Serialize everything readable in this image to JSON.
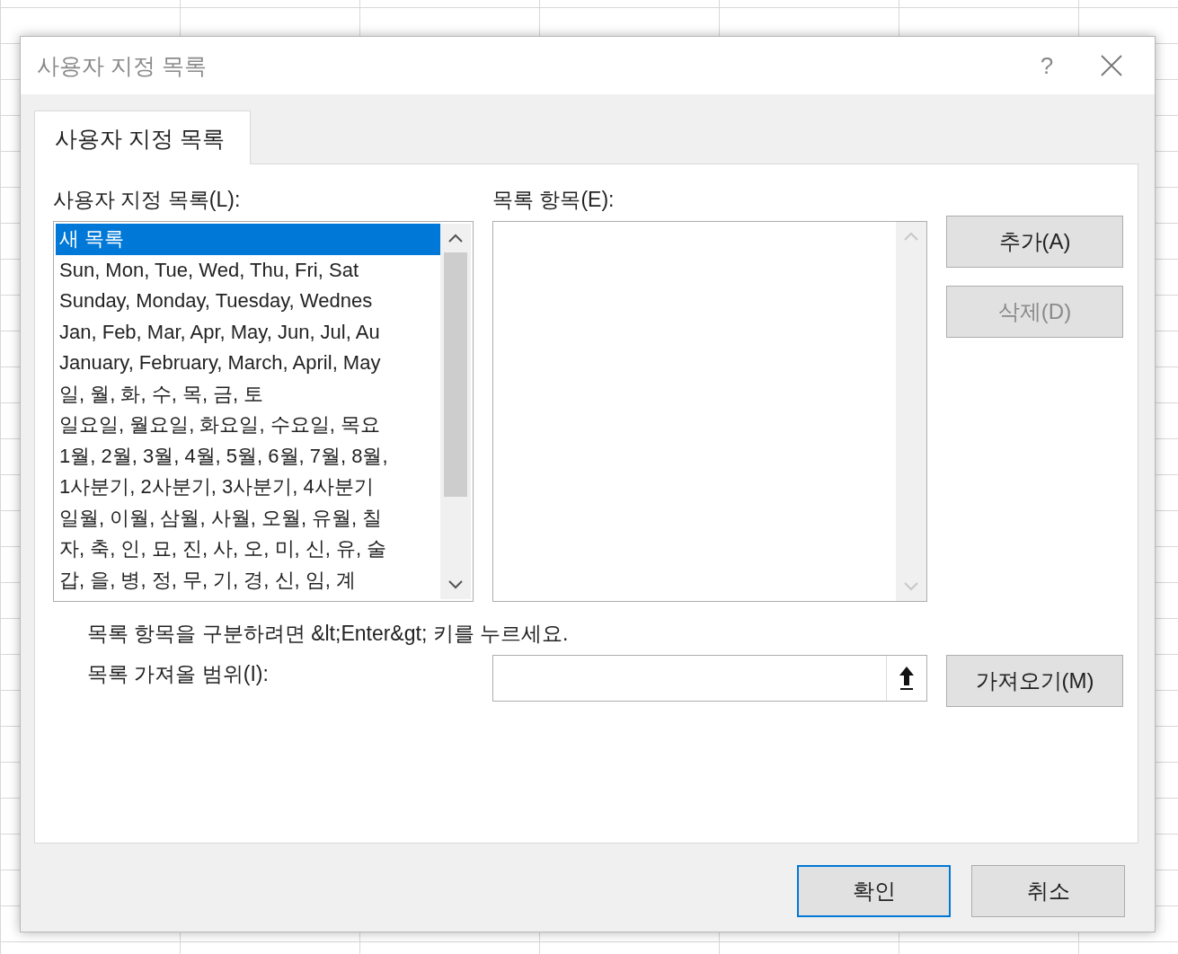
{
  "window": {
    "title": "사용자 지정 목록",
    "help": "?"
  },
  "tabs": [
    {
      "label": "사용자 지정 목록",
      "selected": true
    }
  ],
  "custom_lists": {
    "label": "사용자 지정 목록(L):",
    "items": [
      {
        "text": "새 목록",
        "selected": true
      },
      {
        "text": "Sun, Mon, Tue, Wed, Thu, Fri, Sat",
        "selected": false
      },
      {
        "text": "Sunday, Monday, Tuesday, Wednes",
        "selected": false
      },
      {
        "text": "Jan, Feb, Mar, Apr, May, Jun, Jul, Au",
        "selected": false
      },
      {
        "text": "January, February, March, April, May",
        "selected": false
      },
      {
        "text": "일, 월, 화, 수, 목, 금, 토",
        "selected": false
      },
      {
        "text": "일요일, 월요일, 화요일, 수요일, 목요",
        "selected": false
      },
      {
        "text": "1월, 2월, 3월, 4월, 5월, 6월, 7월, 8월,",
        "selected": false
      },
      {
        "text": "1사분기, 2사분기, 3사분기, 4사분기",
        "selected": false
      },
      {
        "text": "일월, 이월, 삼월, 사월, 오월, 유월, 칠",
        "selected": false
      },
      {
        "text": "자, 축, 인, 묘, 진, 사, 오, 미, 신, 유, 술",
        "selected": false
      },
      {
        "text": "갑, 을, 병, 정, 무, 기, 경, 신, 임, 계",
        "selected": false
      }
    ]
  },
  "list_entries": {
    "label": "목록 항목(E):"
  },
  "side_buttons": [
    {
      "label": "추가(A)",
      "disabled": false
    },
    {
      "label": "삭제(D)",
      "disabled": true
    }
  ],
  "hint": "목록 항목을 구분하려면 &lt;Enter&gt; 키를 누르세요.",
  "import_range": {
    "label": "목록 가져올 범위(I):",
    "button": "가져오기(M)"
  },
  "footer_buttons": [
    {
      "label": "확인",
      "default": true
    },
    {
      "label": "취소",
      "default": false
    }
  ]
}
